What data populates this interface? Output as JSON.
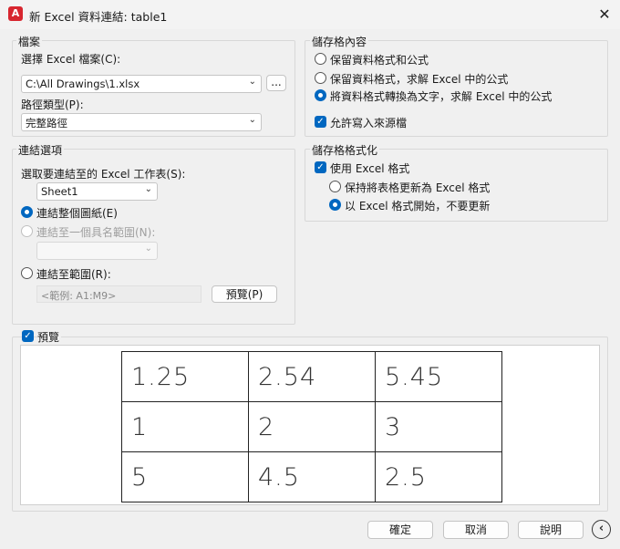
{
  "window": {
    "title": "新 Excel 資料連結: table1",
    "app_icon": "A"
  },
  "file_group": {
    "label": "檔案",
    "select_file_label": "選擇 Excel 檔案(C):",
    "file_path": "C:\\All Drawings\\1.xlsx",
    "browse_label": "...",
    "path_type_label": "路徑類型(P):",
    "path_type_value": "完整路徑"
  },
  "link_group": {
    "label": "連結選項",
    "sheet_label": "選取要連結至的 Excel 工作表(S):",
    "sheet_value": "Sheet1",
    "opt_entire_sheet": "連結整個圖紙(E)",
    "opt_named_range": "連結至一個具名範圍(N):",
    "named_range_value": "",
    "opt_range": "連結至範圍(R):",
    "range_placeholder": "<範例: A1:M9>",
    "preview_button": "預覽(P)"
  },
  "cell_content_group": {
    "label": "儲存格內容",
    "opt_keep_data_formula": "保留資料格式和公式",
    "opt_keep_data_solve": "保留資料格式，求解 Excel 中的公式",
    "opt_convert_text": "將資料格式轉換為文字，求解 Excel 中的公式",
    "allow_writeback": "允許寫入來源檔"
  },
  "cell_format_group": {
    "label": "儲存格格式化",
    "use_excel_format": "使用 Excel 格式",
    "opt_keep_updated": "保持將表格更新為 Excel 格式",
    "opt_start_excel": "以 Excel 格式開始，不要更新"
  },
  "preview": {
    "label": "預覽",
    "table": [
      [
        "1.25",
        "2.54",
        "5.45"
      ],
      [
        "1",
        "2",
        "3"
      ],
      [
        "5",
        "4.5",
        "2.5"
      ]
    ]
  },
  "footer": {
    "ok": "確定",
    "cancel": "取消",
    "help": "說明"
  },
  "colors": {
    "accent": "#0067c0",
    "brand": "#d7262f"
  }
}
